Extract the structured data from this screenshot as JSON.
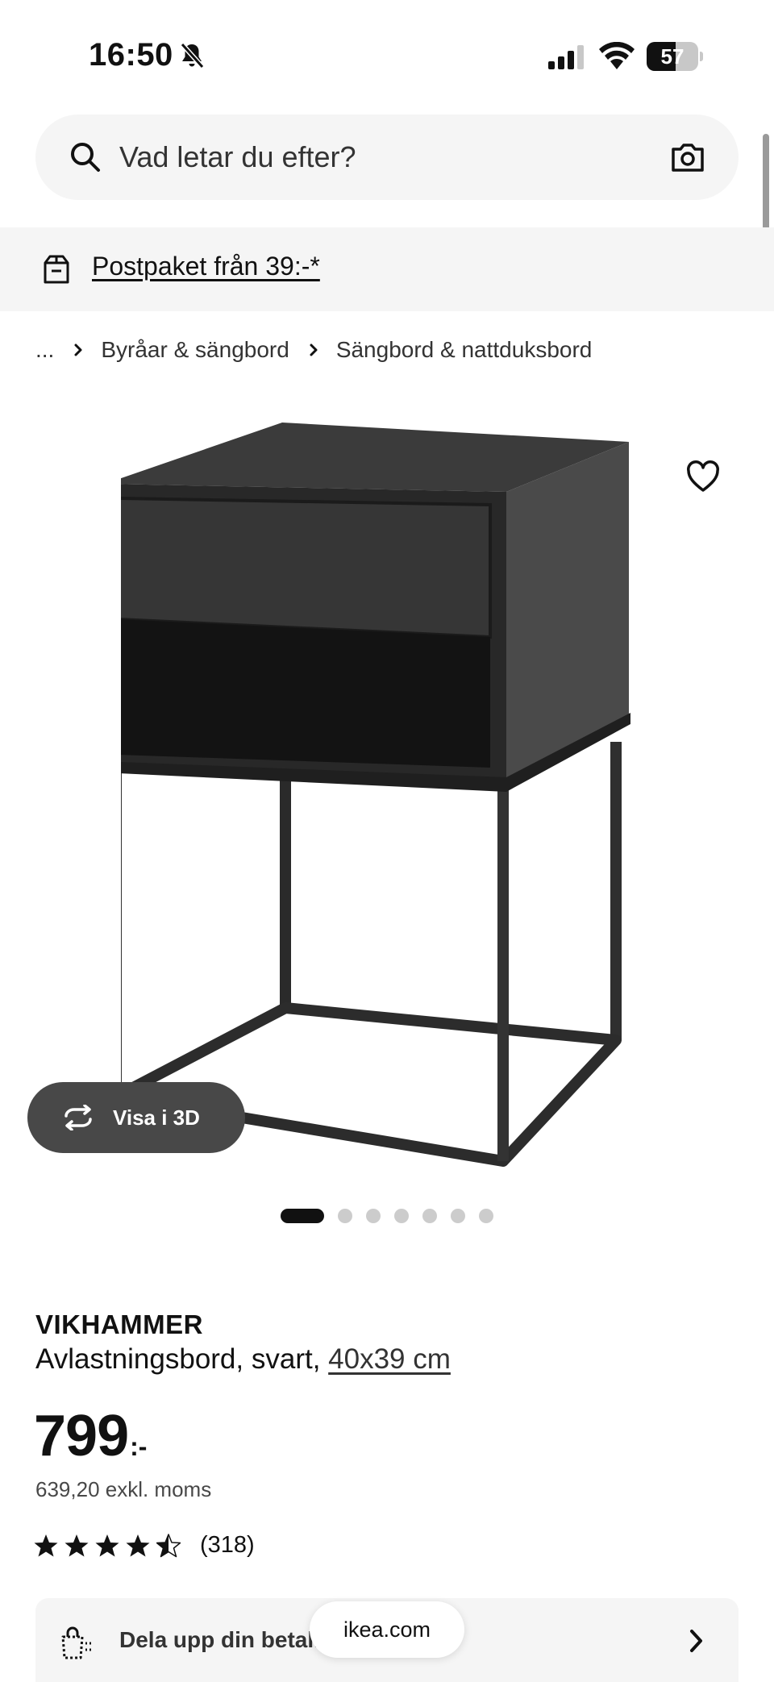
{
  "status_bar": {
    "time": "16:50",
    "battery_level": "57",
    "battery_fraction": 0.57
  },
  "search": {
    "placeholder": "Vad letar du efter?"
  },
  "promo": {
    "link_text": "Postpaket från 39:-*"
  },
  "breadcrumb": {
    "items": [
      "...",
      "Byråar & sängbord",
      "Sängbord & nattduksbord"
    ]
  },
  "product": {
    "name": "VIKHAMMER",
    "description": "Avlastningsbord, svart, ",
    "size": "40x39 cm",
    "price": "799",
    "price_suffix": ":-",
    "price_excl_vat": "639,20 exkl. moms",
    "rating_value": 4.5,
    "rating_max": 5,
    "review_count": "(318)"
  },
  "gallery": {
    "view_3d_label": "Visa i 3D",
    "image_count": 7,
    "active_index": 0
  },
  "payment": {
    "label": "Dela upp din betal..."
  },
  "browser": {
    "url": "ikea.com"
  },
  "icons": {
    "search": "search-icon",
    "camera": "camera-icon",
    "box": "box-icon",
    "favorite": "heart-icon",
    "rotate": "rotate-3d-icon",
    "payment": "shopping-bag-icon"
  },
  "colors": {
    "surface": "#f5f5f5",
    "text": "#111111",
    "button_3d": "#484848",
    "dot_inactive": "#cccccc",
    "dot_active": "#111111"
  }
}
